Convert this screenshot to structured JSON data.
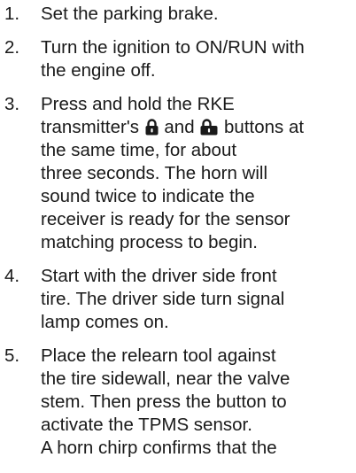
{
  "steps": [
    {
      "number": "1.",
      "lines": [
        "Set the parking brake."
      ]
    },
    {
      "number": "2.",
      "lines": [
        "Turn the ignition to ON/RUN with",
        "the engine off."
      ]
    },
    {
      "number": "3.",
      "line_1": "Press and hold the RKE",
      "line_2_before_lock": "transmitter's",
      "line_2_between_icons": "and",
      "line_2_after_unlock": "buttons at",
      "lines_after": [
        "the same time, for about",
        "three seconds. The horn will",
        "sound twice to indicate the",
        "receiver is ready for the sensor",
        "matching process to begin."
      ],
      "icons": [
        "lock-icon",
        "unlock-icon"
      ]
    },
    {
      "number": "4.",
      "lines": [
        "Start with the driver side front",
        "tire. The driver side turn signal",
        "lamp comes on."
      ]
    },
    {
      "number": "5.",
      "lines": [
        "Place the relearn tool against",
        "the tire sidewall, near the valve",
        "stem. Then press the button to",
        "activate the TPMS sensor.",
        "A horn chirp confirms that the"
      ]
    }
  ]
}
